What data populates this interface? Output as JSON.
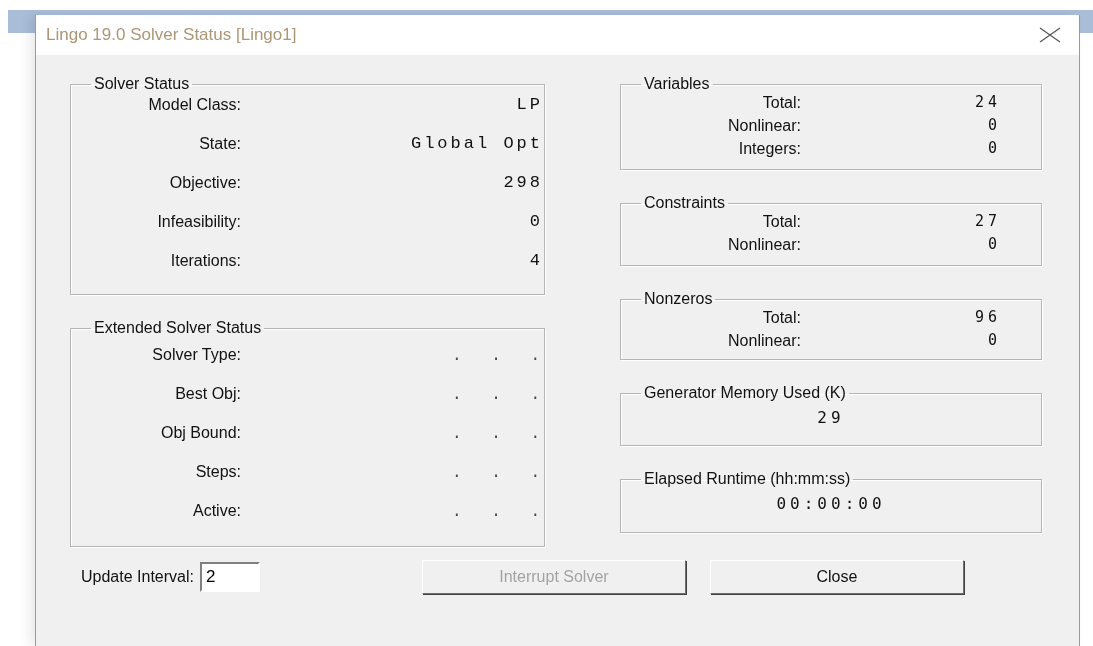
{
  "window": {
    "title": "Lingo 19.0 Solver Status [Lingo1]"
  },
  "left_groups": [
    {
      "title": "Solver Status",
      "kind": "mono",
      "rows": [
        {
          "label": "Model Class:",
          "value": "LP"
        },
        {
          "label": "State:",
          "value": "Global Opt"
        },
        {
          "label": "Objective:",
          "value": "298"
        },
        {
          "label": "Infeasibility:",
          "value": "0"
        },
        {
          "label": "Iterations:",
          "value": "4"
        }
      ]
    },
    {
      "title": "Extended Solver Status",
      "kind": "dots",
      "rows": [
        {
          "label": "Solver Type:",
          "value": ". . ."
        },
        {
          "label": "Best Obj:",
          "value": ". . ."
        },
        {
          "label": "Obj Bound:",
          "value": ". . ."
        },
        {
          "label": "Steps:",
          "value": ". . ."
        },
        {
          "label": "Active:",
          "value": ". . ."
        }
      ]
    }
  ],
  "right_groups": [
    {
      "title": "Variables",
      "kind": "table",
      "rows": [
        {
          "label": "Total:",
          "value": "24"
        },
        {
          "label": "Nonlinear:",
          "value": "0"
        },
        {
          "label": "Integers:",
          "value": "0"
        }
      ]
    },
    {
      "title": "Constraints",
      "kind": "table",
      "rows": [
        {
          "label": "Total:",
          "value": "27"
        },
        {
          "label": "Nonlinear:",
          "value": "0"
        }
      ]
    },
    {
      "title": "Nonzeros",
      "kind": "table",
      "rows": [
        {
          "label": "Total:",
          "value": "96"
        },
        {
          "label": "Nonlinear:",
          "value": "0"
        }
      ]
    },
    {
      "title": "Generator Memory Used (K)",
      "kind": "single",
      "value": "29"
    },
    {
      "title": "Elapsed Runtime (hh:mm:ss)",
      "kind": "single",
      "value": "00:00:00"
    }
  ],
  "update_interval": {
    "label": "Update Interval:",
    "value": "2"
  },
  "buttons": [
    {
      "label": "Interrupt Solver",
      "disabled": true
    },
    {
      "label": "Close",
      "disabled": false
    }
  ]
}
